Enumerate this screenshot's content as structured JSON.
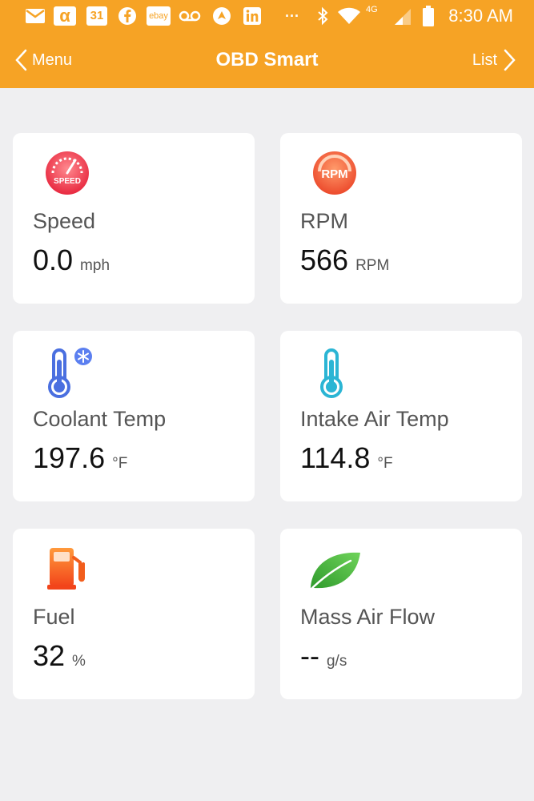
{
  "status_bar": {
    "app_icons": [
      "mail-icon",
      "alpha-icon",
      "calendar-icon",
      "facebook-icon",
      "ebay-icon",
      "voicemail-icon",
      "navigation-icon",
      "linkedin-icon",
      "more-icon"
    ],
    "calendar_day": "31",
    "ebay_label": "ebay",
    "more_label": "···",
    "network_label": "4G",
    "time": "8:30 AM"
  },
  "nav": {
    "back_label": "Menu",
    "title": "OBD Smart",
    "list_label": "List"
  },
  "colors": {
    "accent": "#f6a325",
    "speed_icon": "#f2455a",
    "rpm_icon": "#f05a3c",
    "coolant_icon": "#4a6fe0",
    "intake_icon": "#2bb5d4",
    "fuel_icon": "#f25d1c",
    "maf_icon": "#3fae3c"
  },
  "cards": [
    {
      "label": "Speed",
      "value": "0.0",
      "unit": "mph",
      "icon": "speedometer-icon",
      "icon_text": "SPEED"
    },
    {
      "label": "RPM",
      "value": "566",
      "unit": "RPM",
      "icon": "rpm-gauge-icon",
      "icon_text": "RPM"
    },
    {
      "label": "Coolant Temp",
      "value": "197.6",
      "unit": "°F",
      "icon": "coolant-thermometer-icon"
    },
    {
      "label": "Intake Air Temp",
      "value": "114.8",
      "unit": "°F",
      "icon": "intake-thermometer-icon"
    },
    {
      "label": "Fuel",
      "value": "32",
      "unit": "%",
      "icon": "fuel-pump-icon"
    },
    {
      "label": "Mass Air Flow",
      "value": "--",
      "unit": "g/s",
      "icon": "leaf-icon"
    }
  ]
}
